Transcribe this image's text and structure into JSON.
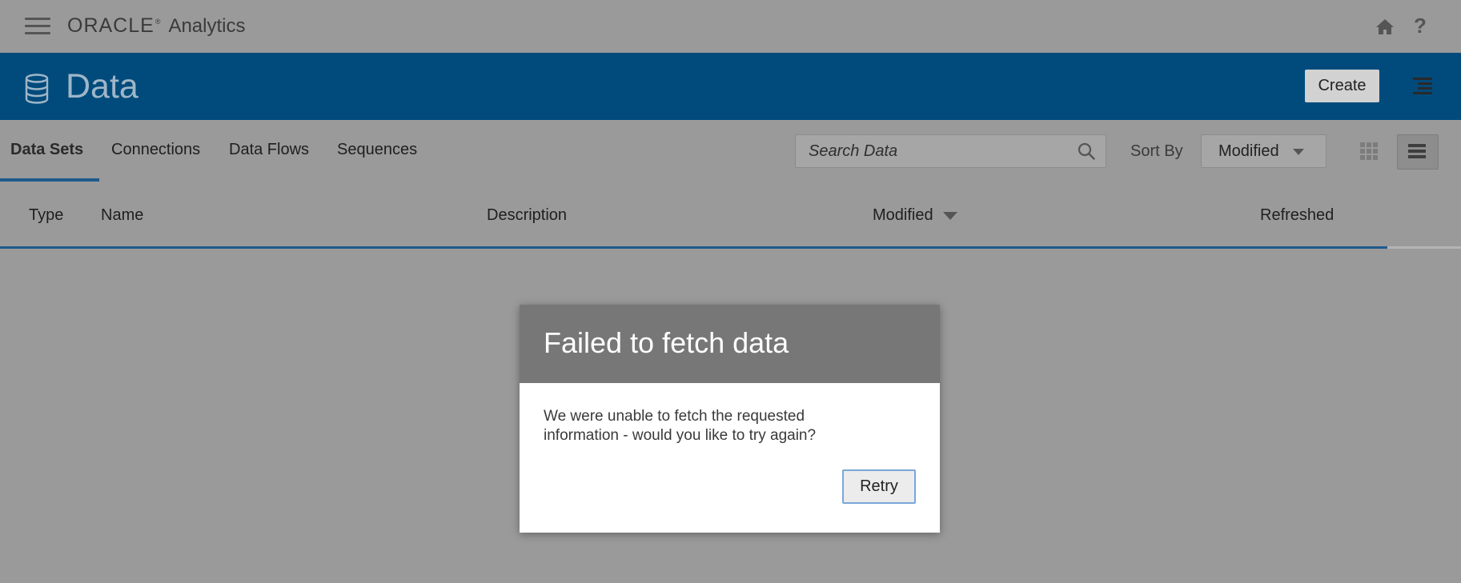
{
  "topbar": {
    "brand_logo": "ORACLE",
    "brand_mark": "®",
    "product": "Analytics"
  },
  "header": {
    "title": "Data",
    "create_label": "Create"
  },
  "tabs": [
    {
      "label": "Data Sets",
      "active": true
    },
    {
      "label": "Connections",
      "active": false
    },
    {
      "label": "Data Flows",
      "active": false
    },
    {
      "label": "Sequences",
      "active": false
    }
  ],
  "search": {
    "placeholder": "Search Data",
    "value": ""
  },
  "sort": {
    "label": "Sort By",
    "selected": "Modified"
  },
  "table": {
    "columns": [
      "Type",
      "Name",
      "Description",
      "Modified",
      "Refreshed"
    ],
    "sorted_column": "Modified",
    "sort_direction": "descending"
  },
  "dialog": {
    "title": "Failed to fetch data",
    "message": "We were unable to fetch the requested information - would you like to try again?",
    "retry_label": "Retry"
  },
  "colors": {
    "header_blue": "#004b7c",
    "accent_blue": "#1f5a8c",
    "overlay_gray": "#9a9a9a"
  }
}
